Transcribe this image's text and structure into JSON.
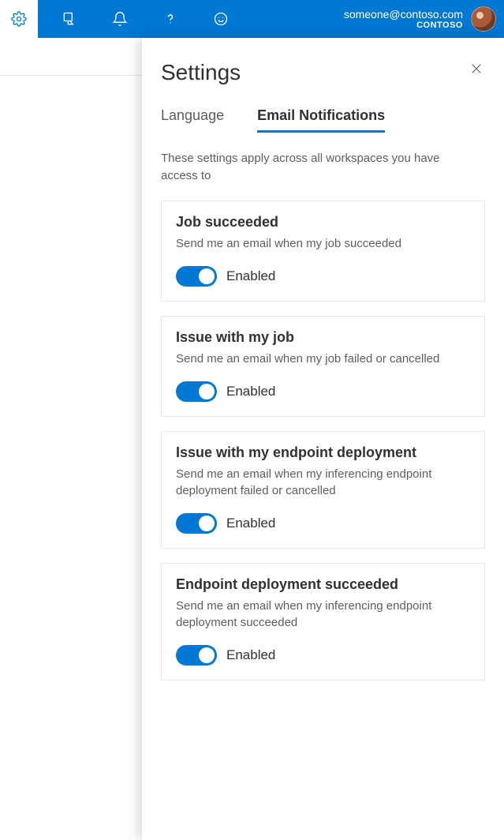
{
  "topbar": {
    "account_email": "someone@contoso.com",
    "account_org": "CONTOSO"
  },
  "panel": {
    "title": "Settings",
    "tabs": {
      "language": "Language",
      "email_notifications": "Email Notifications"
    },
    "description": "These settings apply across all workspaces you have access to",
    "cards": [
      {
        "title": "Job succeeded",
        "desc": "Send me an email when my job succeeded",
        "state_label": "Enabled",
        "enabled": true
      },
      {
        "title": "Issue with my job",
        "desc": "Send me an email when my job failed or cancelled",
        "state_label": "Enabled",
        "enabled": true
      },
      {
        "title": "Issue with my endpoint deployment",
        "desc": "Send me an email when my inferencing endpoint deployment failed or cancelled",
        "state_label": "Enabled",
        "enabled": true
      },
      {
        "title": "Endpoint deployment succeeded",
        "desc": "Send me an email when my inferencing endpoint deployment succeeded",
        "state_label": "Enabled",
        "enabled": true
      }
    ]
  }
}
